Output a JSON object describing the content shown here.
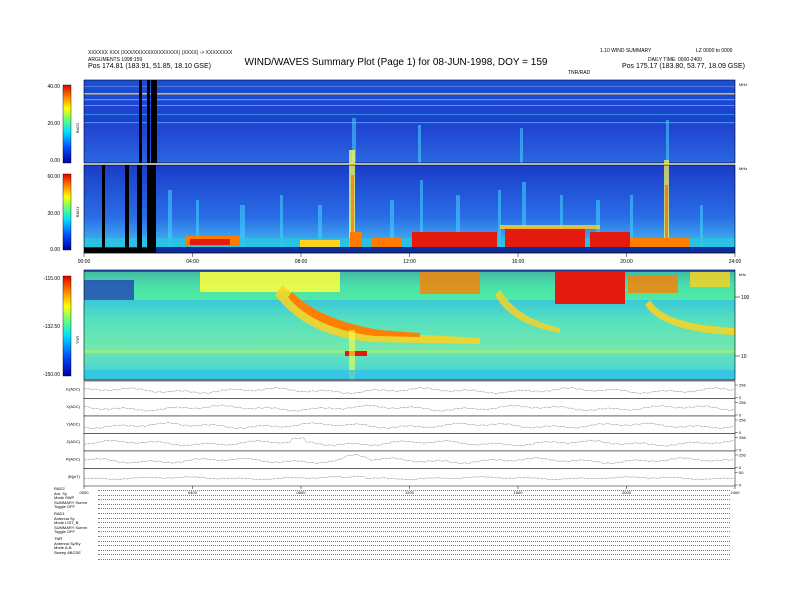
{
  "header": {
    "title": "WIND/WAVES Summary Plot (Page 1) for 08-JUN-1998, DOY = 159",
    "left_line1": "XXXXXX XXX (XXX/XXXXXX/XXXXXXX) (XXXX) -> XXXXXXXX",
    "left_line2": "ARGUMENTS 1998:159",
    "left_pos": "Pos  174.81 (183.91, 51.85, 18.10 GSE)",
    "right_line1a": "1.10 WIND SUMMARY",
    "right_line1b": "LZ 0000 to 0000",
    "right_line2": "DAILY TIME: 0000-2400",
    "right_pos": "Pos  175.17 (183.80, 53.77, 18.09 GSE)",
    "sub_label": "TNR/RAD"
  },
  "axis_time_labels": [
    "00:00",
    "04:00",
    "08:00",
    "12:00",
    "16:00",
    "20:00",
    "24:00"
  ],
  "bottom_axis_labels": [
    "0000",
    "0400",
    "0800",
    "1200",
    "1600",
    "2000",
    "2400"
  ],
  "rad2": {
    "name": "RAD2",
    "ticks": [
      "40.00",
      "20.00",
      "0.00"
    ],
    "unit": "MHz"
  },
  "rad1": {
    "name": "RAD1",
    "ticks": [
      "60.00",
      "30.00",
      "0.00"
    ],
    "unit": "MHz"
  },
  "tnr": {
    "name": "TNR",
    "ticks": [
      "-115.00",
      "-132.50",
      "-150.00"
    ],
    "right_ticks": [
      "100",
      "10"
    ],
    "right_label": "kHz"
  },
  "line_panels": [
    {
      "label": "E(ADC)",
      "right_ticks": [
        "256",
        "0"
      ]
    },
    {
      "label": "X(ADC)",
      "right_ticks": [
        "256",
        "0"
      ]
    },
    {
      "label": "Y(ADC)",
      "right_ticks": [
        "256",
        "0"
      ]
    },
    {
      "label": "Z(ADC)",
      "right_ticks": [
        "256",
        "0"
      ]
    },
    {
      "label": "R(ADC)",
      "right_ticks": [
        "256",
        "0"
      ]
    },
    {
      "label": "|B|(nT)",
      "right_ticks": [
        "50",
        "0"
      ]
    }
  ],
  "params": {
    "rad2": [
      "RAD2",
      "Ant.   Sy",
      "Mode   SWP",
      "SUMMARY  Summ",
      "Toggle   OFF"
    ],
    "rad1": [
      "RAD1",
      "Antenna   Sy",
      "Mode   LIST_B",
      "SUMMARY  Summ",
      "Toggle   OFF"
    ],
    "tnr": [
      "TNR",
      "Antenna   Sy/Ey",
      "Mode   A-B",
      "Sweep  ABCDE"
    ]
  },
  "colors": {
    "spectrogram_low": "#1427c8",
    "spectrogram_mid": "#14c8c8",
    "spectrogram_high": "#ffe214",
    "spectrogram_max": "#e31b0f"
  }
}
